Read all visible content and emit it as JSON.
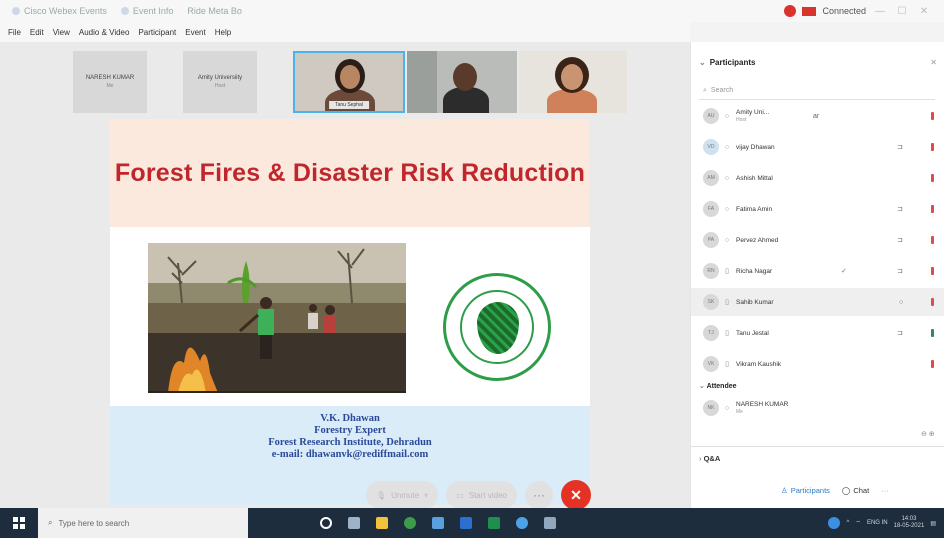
{
  "window": {
    "tabs": [
      "Cisco Webex Events",
      "Event Info",
      "Ride Meta Bo"
    ],
    "connection": "Connected",
    "controls": [
      "—",
      "☐",
      "✕"
    ]
  },
  "menu": [
    "File",
    "Edit",
    "View",
    "Audio & Video",
    "Participant",
    "Event",
    "Help"
  ],
  "thumbnails": {
    "cards": [
      {
        "name": "NARESH KUMAR",
        "role": "Me"
      },
      {
        "name": "Amity Universiity",
        "role": "Host"
      }
    ],
    "videos": [
      {
        "label": "Tanu Sephal"
      },
      {
        "label": ""
      },
      {
        "label": ""
      }
    ]
  },
  "slide": {
    "title": "Forest Fires & Disaster Risk Reduction",
    "credit": [
      "V.K. Dhawan",
      "Forestry Expert",
      "Forest Research Institute, Dehradun",
      "e-mail: dhawanvk@rediffmail.com"
    ]
  },
  "controls": {
    "unmute": "Unmute",
    "start_video": "Start video",
    "more": "···",
    "end": "✕"
  },
  "panel": {
    "title": "Participants",
    "search_placeholder": "Search",
    "participants": [
      {
        "initials": "AU",
        "name": "Amity Uni...",
        "role": "Host",
        "extra": "ar",
        "icon": "",
        "mic": "off"
      },
      {
        "initials": "VD",
        "name": "vijay Dhawan",
        "role": "",
        "extra": "",
        "icon": "⊐",
        "mic": "off"
      },
      {
        "initials": "AM",
        "name": "Ashish Mittal",
        "role": "",
        "extra": "",
        "icon": "",
        "mic": "off"
      },
      {
        "initials": "FA",
        "name": "Fatima Amin",
        "role": "",
        "extra": "",
        "icon": "⊐",
        "mic": "off"
      },
      {
        "initials": "PA",
        "name": "Pervez Ahmed",
        "role": "",
        "extra": "",
        "icon": "⊐",
        "mic": "off"
      },
      {
        "initials": "RN",
        "name": "Richa Nagar",
        "role": "",
        "extra": "✓",
        "icon": "⊐",
        "mic": "off"
      },
      {
        "initials": "SK",
        "name": "Sahib Kumar",
        "role": "",
        "extra": "",
        "icon": "○",
        "mic": "off"
      },
      {
        "initials": "TJ",
        "name": "Tanu Jestal",
        "role": "",
        "extra": "",
        "icon": "⊐",
        "mic": "on"
      },
      {
        "initials": "VK",
        "name": "Vikram Kaushik",
        "role": "",
        "extra": "",
        "icon": "",
        "mic": "off"
      }
    ],
    "attendee_label": "Attendee",
    "attendee": {
      "initials": "NK",
      "name": "NARESH KUMAR",
      "role": "Me"
    },
    "qa": "Q&A",
    "footer": {
      "participants": "Participants",
      "chat": "Chat",
      "more": "···"
    }
  },
  "taskbar": {
    "search_placeholder": "Type here to search",
    "time": "14:03",
    "date": "18-05-2021",
    "lang": "ENG IN"
  }
}
